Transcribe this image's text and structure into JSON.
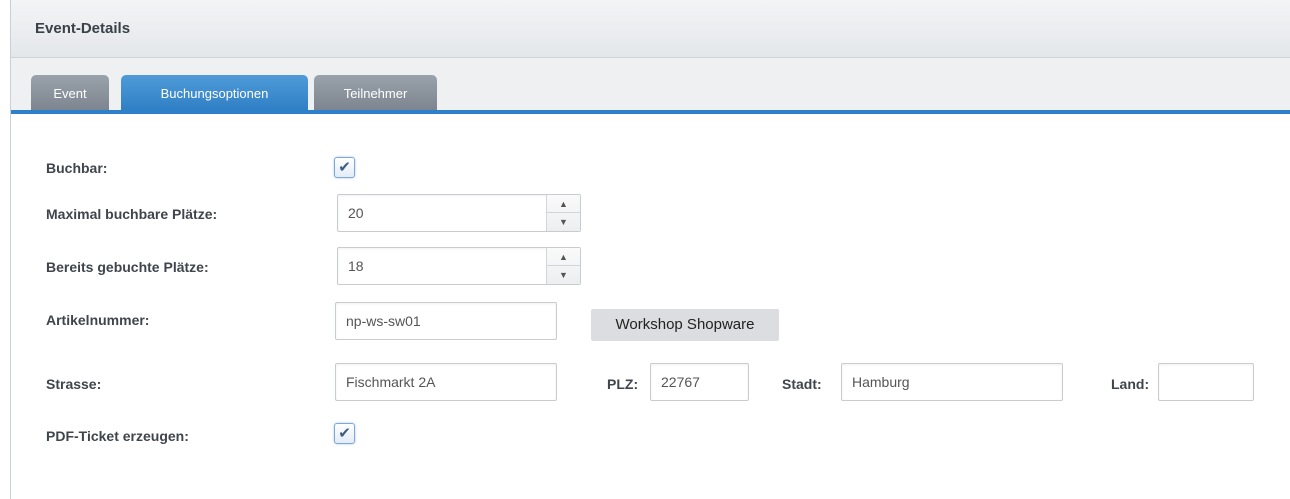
{
  "window": {
    "title": "Event-Details"
  },
  "tabs": [
    {
      "label": "Event",
      "active": false
    },
    {
      "label": "Buchungsoptionen",
      "active": true
    },
    {
      "label": "Teilnehmer",
      "active": false
    }
  ],
  "form": {
    "buchbar": {
      "label": "Buchbar:",
      "checked": true,
      "check_glyph": "✔"
    },
    "max_places": {
      "label": "Maximal buchbare Plätze:",
      "value": "20"
    },
    "booked_places": {
      "label": "Bereits gebuchte Plätze:",
      "value": "18"
    },
    "article_number": {
      "label": "Artikelnummer:",
      "value": "np-ws-sw01",
      "article_name": "Workshop Shopware"
    },
    "street": {
      "label": "Strasse:",
      "value": "Fischmarkt 2A"
    },
    "zip": {
      "label": "PLZ:",
      "value": "22767"
    },
    "city": {
      "label": "Stadt:",
      "value": "Hamburg"
    },
    "country": {
      "label": "Land:",
      "value": ""
    },
    "pdf_ticket": {
      "label": "PDF-Ticket erzeugen:",
      "checked": true,
      "check_glyph": "✔"
    }
  },
  "spinner": {
    "up_glyph": "▲",
    "down_glyph": "▼"
  },
  "colors": {
    "accent": "#2e80c8",
    "inactive_tab": "#8a929b"
  }
}
